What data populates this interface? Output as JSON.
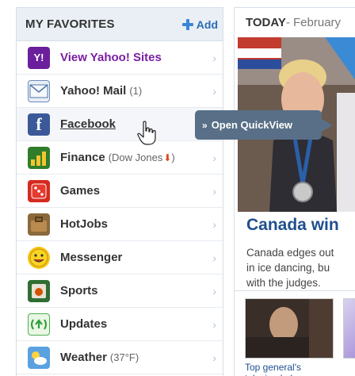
{
  "favorites": {
    "title": "MY FAVORITES",
    "add_label": "Add",
    "items": [
      {
        "label": "View Yahoo! Sites",
        "extra": "",
        "icon": "yahoo-logo-icon"
      },
      {
        "label": "Yahoo! Mail",
        "extra": "(1)",
        "icon": "mail-envelope-icon"
      },
      {
        "label": "Facebook",
        "extra": "",
        "icon": "facebook-logo-icon"
      },
      {
        "label": "Finance",
        "extra": "(Dow Jones",
        "extra_suffix": ")",
        "icon": "finance-chart-icon"
      },
      {
        "label": "Games",
        "extra": "",
        "icon": "dice-icon"
      },
      {
        "label": "HotJobs",
        "extra": "",
        "icon": "briefcase-icon"
      },
      {
        "label": "Messenger",
        "extra": "",
        "icon": "smiley-icon"
      },
      {
        "label": "Sports",
        "extra": "",
        "icon": "sports-icon"
      },
      {
        "label": "Updates",
        "extra": "",
        "icon": "updates-icon"
      },
      {
        "label": "Weather",
        "extra": "(37°F)",
        "icon": "weather-icon"
      }
    ]
  },
  "quickview": {
    "arrows": "»",
    "label": "Open QuickView"
  },
  "today": {
    "label": "TODAY",
    "date": " - February",
    "headline": "Canada win",
    "blurb": [
      "Canada edges out",
      "in ice dancing, bu",
      "with the judges."
    ],
    "thumb_caption": "Top general's televised plea"
  },
  "colors": {
    "accent": "#1f4f8f",
    "purple": "#7b1fa2",
    "quickview_bg": "#586f87",
    "down": "#e0451f"
  }
}
